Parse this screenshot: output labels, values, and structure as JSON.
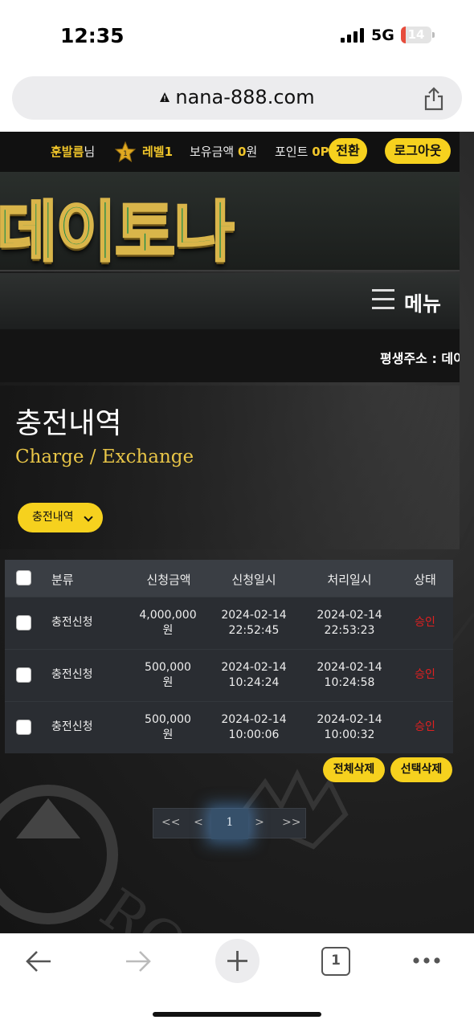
{
  "status_bar": {
    "time": "12:35",
    "network": "5G",
    "battery": "14"
  },
  "browser": {
    "url": "nana-888.com"
  },
  "topbar": {
    "username": "훈발름",
    "user_suffix": "님",
    "level_badge": "1",
    "level": "레벨1",
    "balance_label": "보유금액",
    "balance_value": "0",
    "balance_unit": "원",
    "points_label": "포인트",
    "points_value": "0P",
    "convert_button": "전환",
    "logout_button": "로그아웃"
  },
  "logo": {
    "text": "데이토나"
  },
  "menu": {
    "label": "메뉴"
  },
  "ticker": {
    "text": "평생주소 : 데이"
  },
  "hero": {
    "title": "충전내역",
    "subtitle": "Charge / Exchange",
    "dropdown_label": "충전내역"
  },
  "table": {
    "headers": [
      "분류",
      "신청금액",
      "신청일시",
      "처리일시",
      "상태"
    ],
    "rows": [
      {
        "type": "충전신청",
        "amount": "4,000,000",
        "unit": "원",
        "req_date": "2024-02-14",
        "req_time": "22:52:45",
        "proc_date": "2024-02-14",
        "proc_time": "22:53:23",
        "status": "승인"
      },
      {
        "type": "충전신청",
        "amount": "500,000",
        "unit": "원",
        "req_date": "2024-02-14",
        "req_time": "10:24:24",
        "proc_date": "2024-02-14",
        "proc_time": "10:24:58",
        "status": "승인"
      },
      {
        "type": "충전신청",
        "amount": "500,000",
        "unit": "원",
        "req_date": "2024-02-14",
        "req_time": "10:00:06",
        "proc_date": "2024-02-14",
        "proc_time": "10:00:32",
        "status": "승인"
      }
    ]
  },
  "actions": {
    "delete_all": "전체삭제",
    "delete_selected": "선택삭제"
  },
  "pagination": {
    "first": "<<",
    "prev": "<",
    "current": "1",
    "next": ">",
    "last": ">>"
  },
  "bottom_nav": {
    "tab_count": "1"
  },
  "colors": {
    "accent": "#f6d11e",
    "status_approved": "#e02020",
    "logo_green": "#0e8a4a"
  }
}
